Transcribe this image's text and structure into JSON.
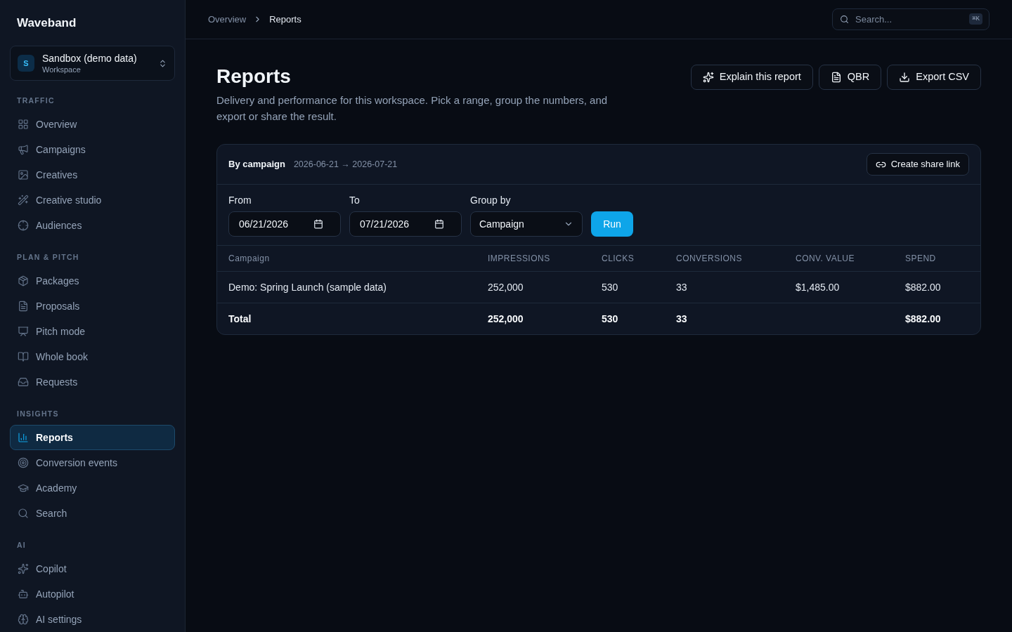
{
  "sidebar": {
    "brand": "Waveband",
    "workspace": {
      "initial": "S",
      "name": "Sandbox (demo data)",
      "subtitle": "Workspace"
    },
    "sections": [
      {
        "heading": "TRAFFIC",
        "items": [
          {
            "label": "Overview",
            "selected": false
          },
          {
            "label": "Campaigns",
            "selected": false
          },
          {
            "label": "Creatives",
            "selected": false
          },
          {
            "label": "Creative studio",
            "selected": false
          },
          {
            "label": "Audiences",
            "selected": false
          }
        ]
      },
      {
        "heading": "PLAN & PITCH",
        "items": [
          {
            "label": "Packages",
            "selected": false
          },
          {
            "label": "Proposals",
            "selected": false
          },
          {
            "label": "Pitch mode",
            "selected": false
          },
          {
            "label": "Whole book",
            "selected": false
          },
          {
            "label": "Requests",
            "selected": false
          }
        ]
      },
      {
        "heading": "INSIGHTS",
        "items": [
          {
            "label": "Reports",
            "selected": true
          },
          {
            "label": "Conversion events",
            "selected": false
          },
          {
            "label": "Academy",
            "selected": false
          },
          {
            "label": "Search",
            "selected": false
          }
        ]
      },
      {
        "heading": "AI",
        "items": [
          {
            "label": "Copilot",
            "selected": false
          },
          {
            "label": "Autopilot",
            "selected": false
          },
          {
            "label": "AI settings",
            "selected": false
          }
        ]
      }
    ]
  },
  "topbar": {
    "breadcrumb": [
      "Overview",
      "Reports"
    ],
    "search": {
      "placeholder": "Search...",
      "shortcut": "⌘K"
    }
  },
  "page": {
    "title": "Reports",
    "description": "Delivery and performance for this workspace. Pick a range, group the numbers, and export or share the result.",
    "actions": [
      "Explain this report",
      "QBR",
      "Export CSV"
    ]
  },
  "report": {
    "title": "By campaign",
    "range": "2026-06-21 → 2026-07-21",
    "share_button": "Create share link",
    "filters": {
      "from": {
        "label": "From",
        "value": "06/21/2026"
      },
      "to": {
        "label": "To",
        "value": "07/21/2026"
      },
      "group_by": {
        "label": "Group by",
        "value": "Campaign"
      },
      "run_button": "Run"
    },
    "table": {
      "columns": [
        "Campaign",
        "IMPRESSIONS",
        "CLICKS",
        "CONVERSIONS",
        "CONV. VALUE",
        "SPEND"
      ],
      "rows": [
        {
          "campaign": "Demo: Spring Launch (sample data)",
          "impressions": "252,000",
          "clicks": "530",
          "conversions": "33",
          "conv_value": "$1,485.00",
          "spend": "$882.00"
        }
      ],
      "total": {
        "campaign": "Total",
        "impressions": "252,000",
        "clicks": "530",
        "conversions": "33",
        "spend": "$882.00"
      }
    }
  }
}
